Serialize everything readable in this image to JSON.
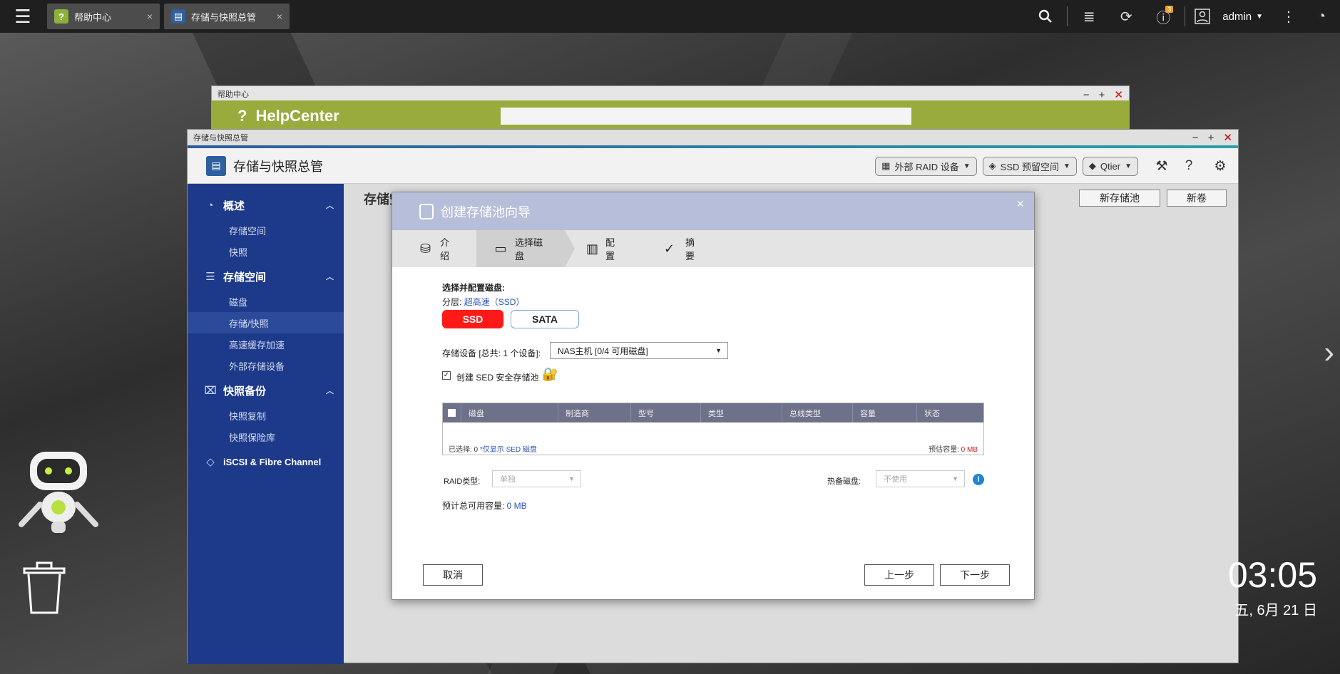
{
  "taskbar": {
    "tabs": [
      {
        "label": "帮助中心",
        "close": "×"
      },
      {
        "label": "存储与快照总管",
        "close": "×"
      }
    ],
    "notification_count": "3",
    "user": "admin"
  },
  "help_window": {
    "title": "帮助中心",
    "logo_text": "HelpCenter",
    "logo_icon": "?"
  },
  "main_window": {
    "title": "存储与快照总管",
    "app_title": "存储与快照总管",
    "toolbar": {
      "external_raid": "外部 RAID 设备",
      "ssd_reserve": "SSD 预留空间",
      "qtier": "Qtier"
    },
    "sidebar": [
      {
        "group": "概述",
        "items": [
          "存储空间",
          "快照"
        ]
      },
      {
        "group": "存储空间",
        "items": [
          "磁盘",
          "存储/快照",
          "高速缓存加速",
          "外部存储设备"
        ]
      },
      {
        "group": "快照备份",
        "items": [
          "快照复制",
          "快照保险库"
        ]
      },
      {
        "group": "iSCSI & Fibre Channel",
        "items": []
      }
    ],
    "content_title": "存储空间/快照",
    "new_pool": "新存储池",
    "new_volume": "新卷"
  },
  "dialog": {
    "title": "创建存储池向导",
    "close": "×",
    "steps": [
      "介绍",
      "选择磁盘",
      "配置",
      "摘要"
    ],
    "section_title": "选择并配置磁盘:",
    "tier_label": "分层:",
    "tier_value": "超高速（SSD）",
    "tier_ssd": "SSD",
    "tier_sata": "SATA",
    "device_label": "存储设备 [总共: 1 个设备]:",
    "device_value": "NAS主机 [0/4 可用磁盘]",
    "sed_label": "创建 SED 安全存储池",
    "table_headers": [
      "磁盘",
      "制造商",
      "型号",
      "类型",
      "总线类型",
      "容量",
      "状态"
    ],
    "selected_prefix": "已选择: 0 ",
    "sed_only_link": "*仅显示 SED 磁盘",
    "estimate_label": "预估容量: ",
    "estimate_value": "0 MB",
    "raid_label": "RAID类型:",
    "raid_value": "单独",
    "spare_label": "热备磁盘:",
    "spare_value": "不使用",
    "total_label": "预计总可用容量: ",
    "total_value": "0 MB",
    "cancel": "取消",
    "prev": "上一步",
    "next": "下一步"
  },
  "desktop": {
    "clock": "03:05",
    "date": "五, 6月 21 日"
  },
  "colors": {
    "sidebar": "#1d3a8a",
    "ssd_button": "#ff1a1a",
    "dialog_header": "#b7bed9"
  }
}
